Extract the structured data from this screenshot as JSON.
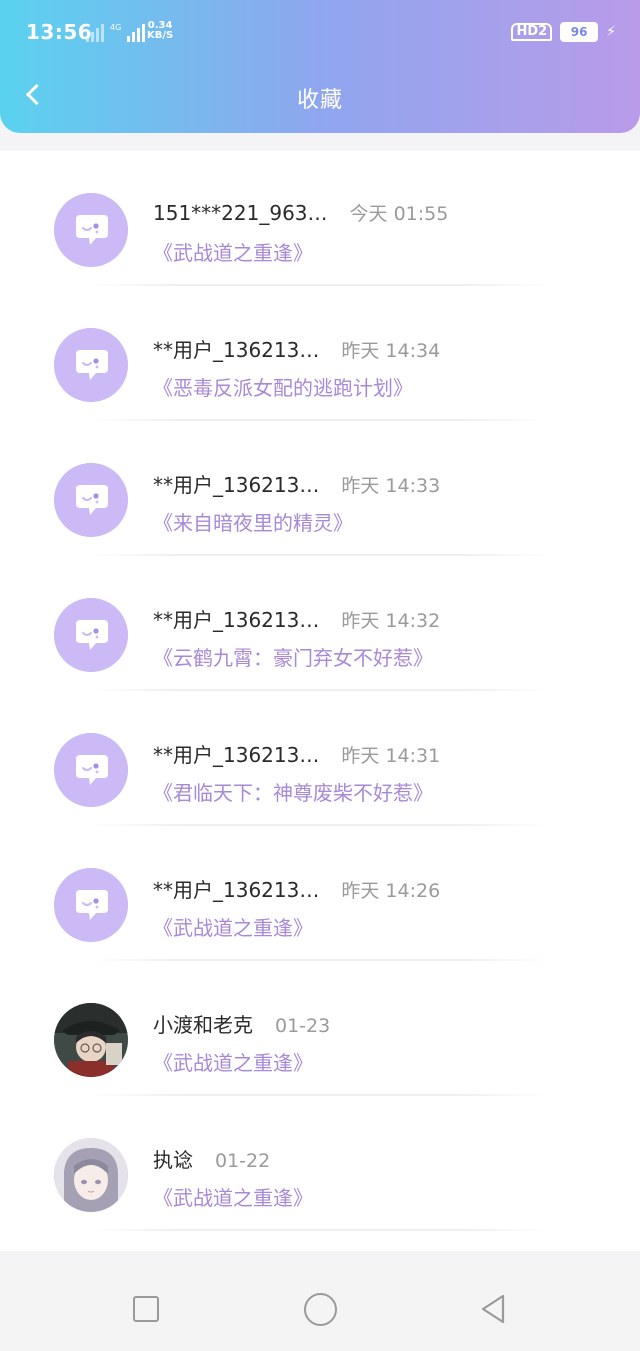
{
  "status_bar": {
    "time": "13:56",
    "net_speed_value": "0.34",
    "net_speed_unit": "KB/S",
    "network_label": "4G",
    "hd_label": "HD2",
    "battery": "96"
  },
  "header": {
    "title": "收藏"
  },
  "items": [
    {
      "user": "151***221_963…",
      "time": "今天 01:55",
      "book": "《武战道之重逢》",
      "avatar": "default"
    },
    {
      "user": "**用户_136213…",
      "time": "昨天 14:34",
      "book": "《恶毒反派女配的逃跑计划》",
      "avatar": "default"
    },
    {
      "user": "**用户_136213…",
      "time": "昨天 14:33",
      "book": "《来自暗夜里的精灵》",
      "avatar": "default"
    },
    {
      "user": "**用户_136213…",
      "time": "昨天 14:32",
      "book": "《云鹤九霄：豪门弃女不好惹》",
      "avatar": "default"
    },
    {
      "user": "**用户_136213…",
      "time": "昨天 14:31",
      "book": "《君临天下：神尊废柴不好惹》",
      "avatar": "default"
    },
    {
      "user": "**用户_136213…",
      "time": "昨天 14:26",
      "book": "《武战道之重逢》",
      "avatar": "default"
    },
    {
      "user": "小渡和老克",
      "time": "01-23",
      "book": "《武战道之重逢》",
      "avatar": "photo-dark"
    },
    {
      "user": "执谂",
      "time": "01-22",
      "book": "《武战道之重逢》",
      "avatar": "photo-light"
    }
  ],
  "colors": {
    "header_start": "#5ad2ef",
    "header_end": "#b99be9",
    "book_title": "#a889d8",
    "avatar_default": "#cbbaf5"
  }
}
